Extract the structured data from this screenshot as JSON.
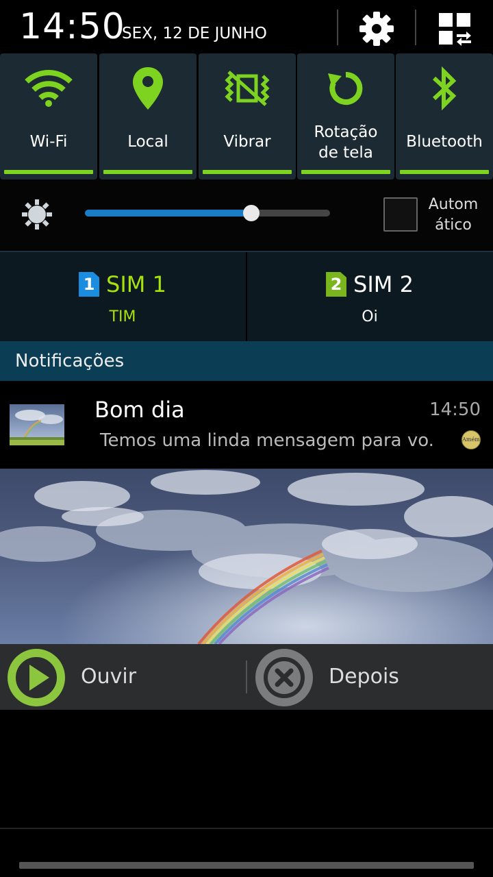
{
  "status": {
    "time": "14:50",
    "date": "SEX, 12 DE JUNHO"
  },
  "header": {
    "settings_icon": "gear-icon",
    "grid_icon": "grid-switch-icon"
  },
  "quick_settings": [
    {
      "label": "Wi-Fi",
      "icon": "wifi-icon",
      "active": true
    },
    {
      "label": "Local",
      "icon": "location-pin-icon",
      "active": true
    },
    {
      "label": "Vibrar",
      "icon": "vibrate-icon",
      "active": true
    },
    {
      "label_line1": "Rotação",
      "label_line2": "de tela",
      "icon": "rotate-icon",
      "active": true
    },
    {
      "label": "Bluetooth",
      "icon": "bluetooth-icon",
      "active": true
    }
  ],
  "brightness": {
    "level": 0.68,
    "auto_label_line1": "Autom",
    "auto_label_line2": "ático",
    "auto_checked": false
  },
  "sims": [
    {
      "num": "1",
      "name": "SIM 1",
      "carrier": "TIM",
      "color": "#a8e10c",
      "badge_color": "#1a8de0"
    },
    {
      "num": "2",
      "name": "SIM 2",
      "carrier": "Oi",
      "color": "#ffffff",
      "badge_color": "#7ab51d"
    }
  ],
  "notifications_header": "Notificações",
  "notification": {
    "title": "Bom dia",
    "time": "14:50",
    "text": "Temos uma linda mensagem para vo.",
    "badge_text": "Amém"
  },
  "actions": [
    {
      "label": "Ouvir",
      "icon": "play-icon"
    },
    {
      "label": "Depois",
      "icon": "close-circle-icon"
    }
  ],
  "colors": {
    "accent_green": "#7ed321",
    "tile_bg": "#1c2a33",
    "notif_header_bg": "#0b3d55",
    "slider_blue": "#1a7bc7"
  }
}
